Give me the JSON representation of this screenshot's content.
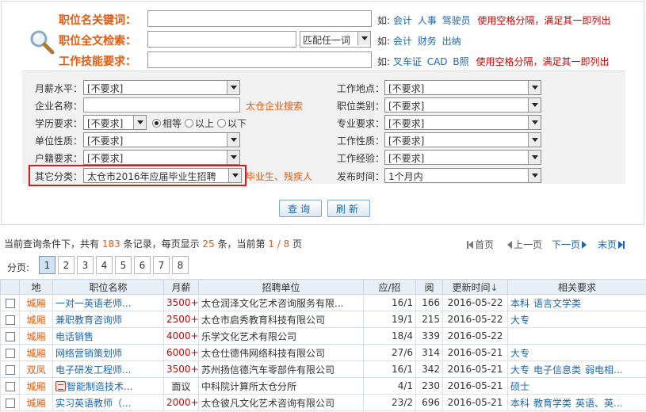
{
  "search": {
    "keyword_label": "职位名关键词：",
    "fulltext_label": "职位全文检索：",
    "skill_label": "工作技能要求：",
    "keyword_value": "",
    "fulltext_value": "",
    "skill_value": "",
    "match_mode": "匹配任一词",
    "prefix": "如:",
    "keyword_examples": [
      "会计",
      "人事",
      "驾驶员"
    ],
    "fulltext_examples": [
      "会计",
      "财务",
      "出纳"
    ],
    "skill_examples": [
      "叉车证",
      "CAD",
      "B照"
    ],
    "rule_text": "使用空格分隔，满足其一即列出"
  },
  "filters": {
    "salary_label": "月薪水平：",
    "salary_value": "[不要求]",
    "company_label": "企业名称：",
    "company_value": "",
    "company_search_link": "太仓企业搜索",
    "education_label": "学历要求：",
    "education_value": "[不要求]",
    "edu_radios": [
      "相等",
      "以上",
      "以下"
    ],
    "unit_label": "单位性质：",
    "unit_value": "[不要求]",
    "hukou_label": "户籍要求：",
    "hukou_value": "[不要求]",
    "other_label": "其它分类：",
    "other_value": "太仓市2016年应届毕业生招聘",
    "other_extra": "毕业生、残疾人",
    "location_label": "工作地点：",
    "location_value": "[不要求]",
    "category_label": "职位类别：",
    "category_value": "[不要求]",
    "major_label": "专业要求：",
    "major_value": "[不要求]",
    "jobtype_label": "工作性质：",
    "jobtype_value": "[不要求]",
    "experience_label": "工作经验：",
    "experience_value": "[不要求]",
    "publish_label": "发布时间：",
    "publish_value": "1个月内"
  },
  "buttons": {
    "query": "查询",
    "reset": "刷新"
  },
  "summary": {
    "t1": "当前查询条件下，共有",
    "total": "183",
    "t2": "条记录，每页显示",
    "per_page": "25",
    "t3": "条，当前第",
    "current": "1 / 8",
    "t4": "页"
  },
  "pager": {
    "first": "首页",
    "prev": "上一页",
    "next": "下一页",
    "last": "末页",
    "label": "分页:",
    "pages": [
      "1",
      "2",
      "3",
      "4",
      "5",
      "6",
      "7",
      "8"
    ]
  },
  "table": {
    "headers": [
      "地",
      "职位名称",
      "月薪",
      "招聘单位",
      "应/招",
      "阅",
      "更新时间",
      "相关要求"
    ],
    "sort_arrow": "↓",
    "rows": [
      {
        "city": "城厢",
        "title": "一对一英语老师...",
        "salary": "3500+",
        "company": "太仓润泽文化艺术咨询服务有限...",
        "ratio": "16/1",
        "views": "166",
        "date": "2016-05-22",
        "reqs": [
          "本科",
          "语言文学类"
        ]
      },
      {
        "city": "城厢",
        "title": "兼职教育咨询师",
        "salary": "2500+",
        "company": "太仓市启秀教育科技有限公司",
        "ratio": "19/1",
        "views": "215",
        "date": "2016-05-22",
        "reqs": [
          "大专"
        ]
      },
      {
        "city": "城厢",
        "title": "电话销售",
        "salary": "4000+",
        "company": "乐学文化艺术有限公司",
        "ratio": "18/4",
        "views": "339",
        "date": "2016-05-22",
        "reqs": []
      },
      {
        "city": "城厢",
        "title": "网络营销策划师",
        "salary": "6000+",
        "company": "太仓仕德伟网络科技有限公司",
        "ratio": "27/6",
        "views": "314",
        "date": "2016-05-21",
        "reqs": [
          "大专"
        ]
      },
      {
        "city": "双凤",
        "title": "电子研发工程师...",
        "salary": "3500+",
        "company": "苏州扬信德汽车零部件有限公司",
        "ratio": "16/1",
        "views": "342",
        "date": "2016-05-21",
        "reqs": [
          "大专",
          "电子信息类",
          "弱电相..."
        ]
      },
      {
        "city": "城厢",
        "title": "智能制造技术...",
        "salary": "面议",
        "company": "中科院计算所太仓分所",
        "ratio": "4/1",
        "views": "230",
        "date": "2016-05-21",
        "reqs": [
          "硕士"
        ],
        "hot": true
      },
      {
        "city": "城厢",
        "title": "实习英语教师（...",
        "salary": "2000+",
        "company": "太仓彼凡文化艺术咨询有限公司",
        "ratio": "23/2",
        "views": "696",
        "date": "2016-05-21",
        "reqs": [
          "本科",
          "教育学类",
          "英语、英..."
        ]
      }
    ]
  }
}
